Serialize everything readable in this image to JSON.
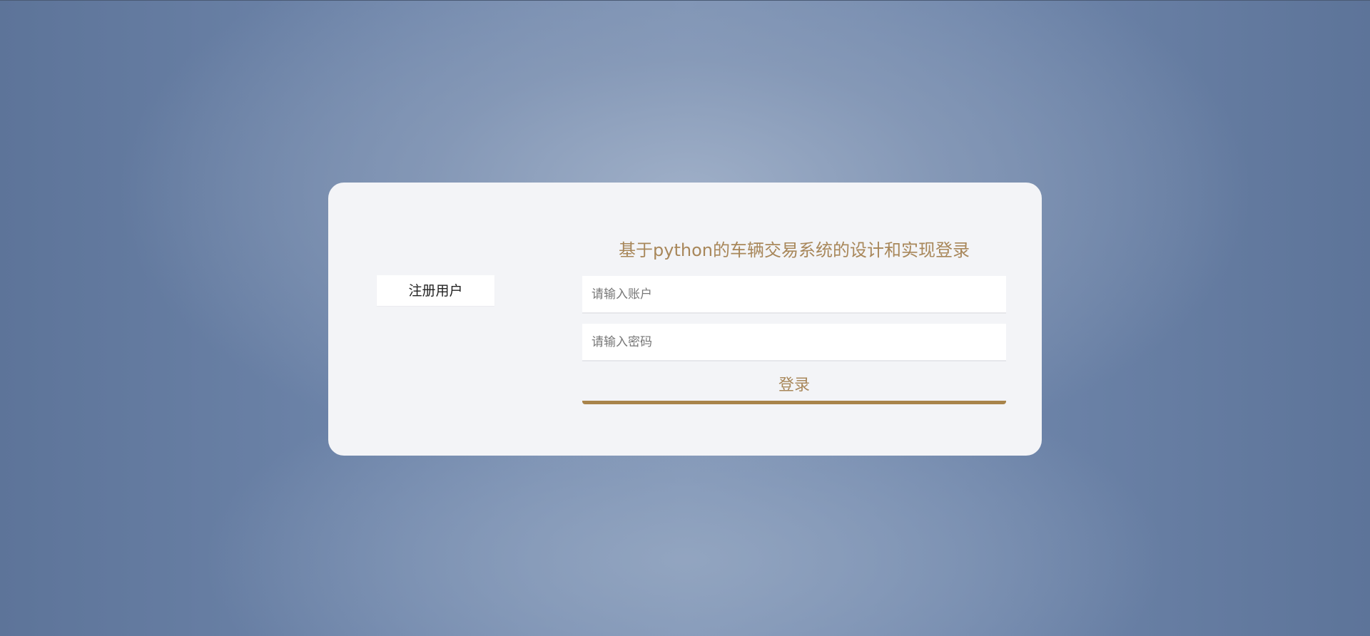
{
  "register": {
    "label": "注册用户"
  },
  "login": {
    "title": "基于python的车辆交易系统的设计和实现登录",
    "account_placeholder": "请输入账户",
    "password_placeholder": "请输入密码",
    "submit_label": "登录"
  },
  "colors": {
    "accent": "#a8875a",
    "card_background": "#f3f4f7",
    "page_background": "#7b91b4"
  }
}
